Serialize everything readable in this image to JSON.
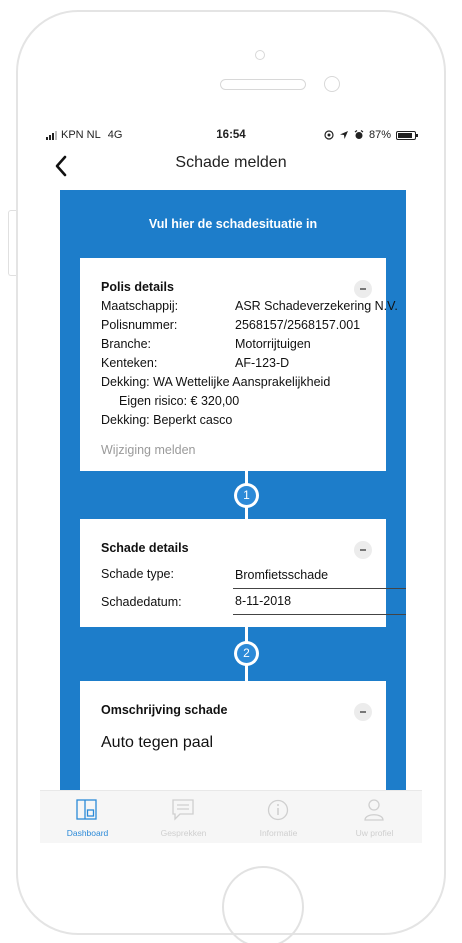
{
  "status_bar": {
    "carrier": "KPN NL",
    "network": "4G",
    "time": "16:54",
    "battery": "87%",
    "battery_level": 0.87
  },
  "nav": {
    "title": "Schade melden",
    "back_icon": "chevron-left-icon"
  },
  "banner": "Vul hier de schadesituatie in",
  "polis": {
    "title": "Polis details",
    "rows": [
      {
        "label": "Maatschappij:",
        "value": "ASR Schadeverzekering N.V."
      },
      {
        "label": "Polisnummer:",
        "value": "2568157/2568157.001"
      },
      {
        "label": "Branche:",
        "value": "Motorrijtuigen"
      },
      {
        "label": "Kenteken:",
        "value": "AF-123-D"
      }
    ],
    "dekking1": "Dekking: WA Wettelijke Aansprakelijkheid",
    "eigen_risico": "Eigen risico: € 320,00",
    "dekking2": "Dekking: Beperkt casco",
    "link": "Wijziging melden"
  },
  "steps": [
    "1",
    "2"
  ],
  "schade": {
    "title": "Schade details",
    "type_label": "Schade type:",
    "type_value": "Bromfietsschade",
    "date_label": "Schadedatum:",
    "date_value": "8-11-2018"
  },
  "omschrijving": {
    "title": "Omschrijving schade",
    "text": "Auto tegen paal"
  },
  "tabs": [
    {
      "label": "Dashboard",
      "icon": "dashboard-icon",
      "active": true
    },
    {
      "label": "Gesprekken",
      "icon": "chat-icon",
      "active": false
    },
    {
      "label": "Informatie",
      "icon": "info-icon",
      "active": false
    },
    {
      "label": "Uw profiel",
      "icon": "user-icon",
      "active": false
    }
  ],
  "colors": {
    "accent": "#1d7dca",
    "tab_active": "#2c8ad8",
    "tab_inactive": "#cfcfcf"
  }
}
